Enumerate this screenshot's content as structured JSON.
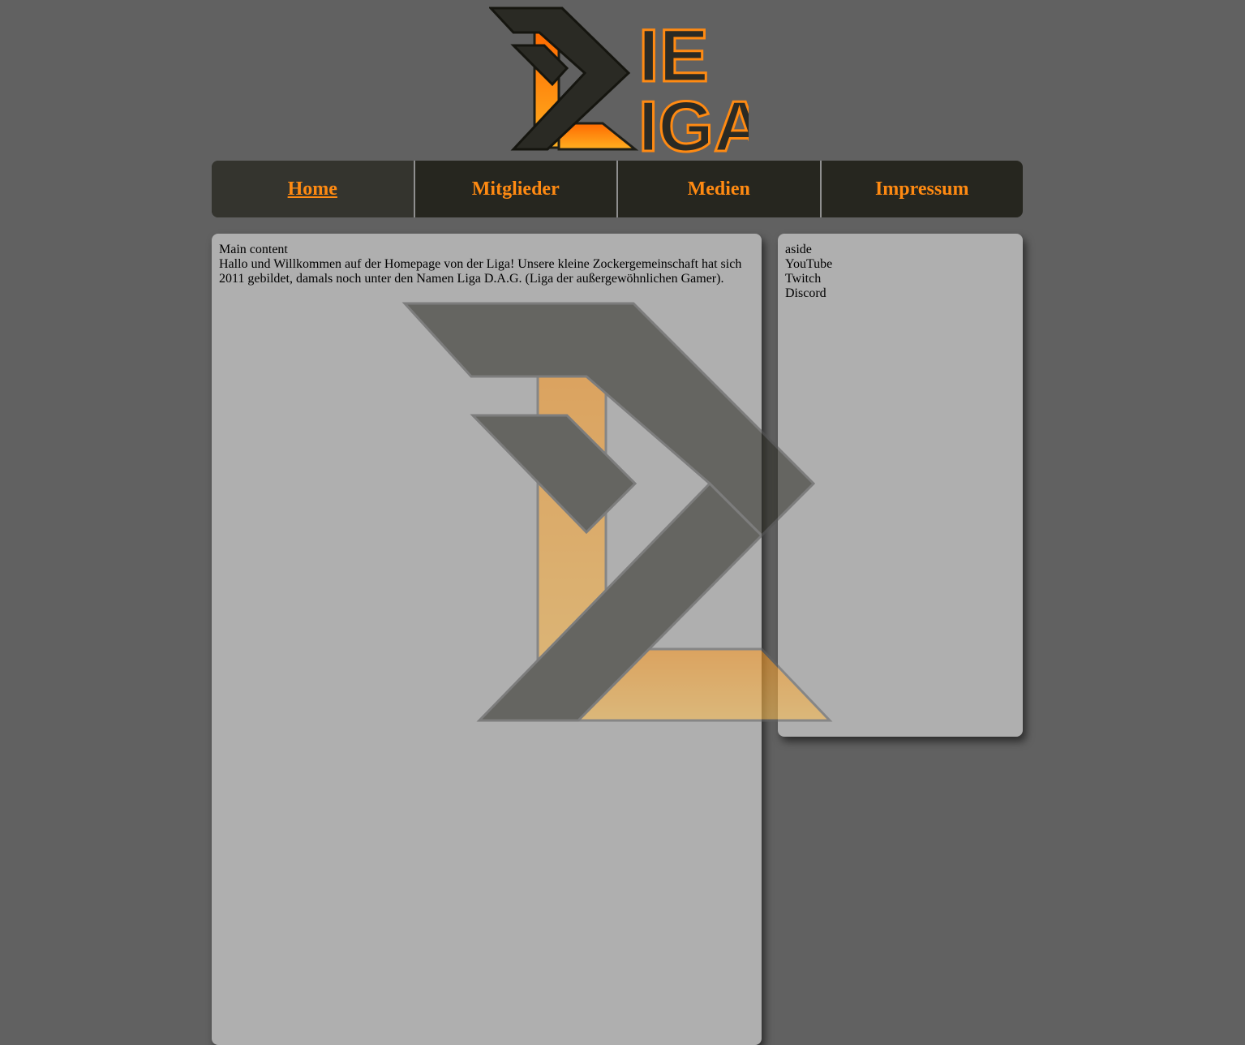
{
  "header": {
    "logo_text_line1": "IE",
    "logo_text_line2": "IGA"
  },
  "nav": {
    "items": [
      {
        "label": "Home",
        "active": true
      },
      {
        "label": "Mitglieder",
        "active": false
      },
      {
        "label": "Medien",
        "active": false
      },
      {
        "label": "Impressum",
        "active": false
      }
    ]
  },
  "main": {
    "heading": "Main content",
    "intro": "Hallo und Willkommen auf der Homepage von der Liga! Unsere kleine Zockergemeinschaft hat sich 2011 gebildet, damals noch unter den Namen Liga D.A.G. (Liga der außergewöhnlichen Gamer)."
  },
  "aside": {
    "heading": "aside",
    "links": [
      "YouTube",
      "Twitch",
      "Discord"
    ]
  },
  "colors": {
    "page_bg": "#616161",
    "nav_bg": "#26261f",
    "accent": "#ff8a12",
    "panel_bg": "#afafaf"
  },
  "icons": {
    "logo": "die-liga-logo",
    "watermark": "liga-emblem-watermark"
  }
}
